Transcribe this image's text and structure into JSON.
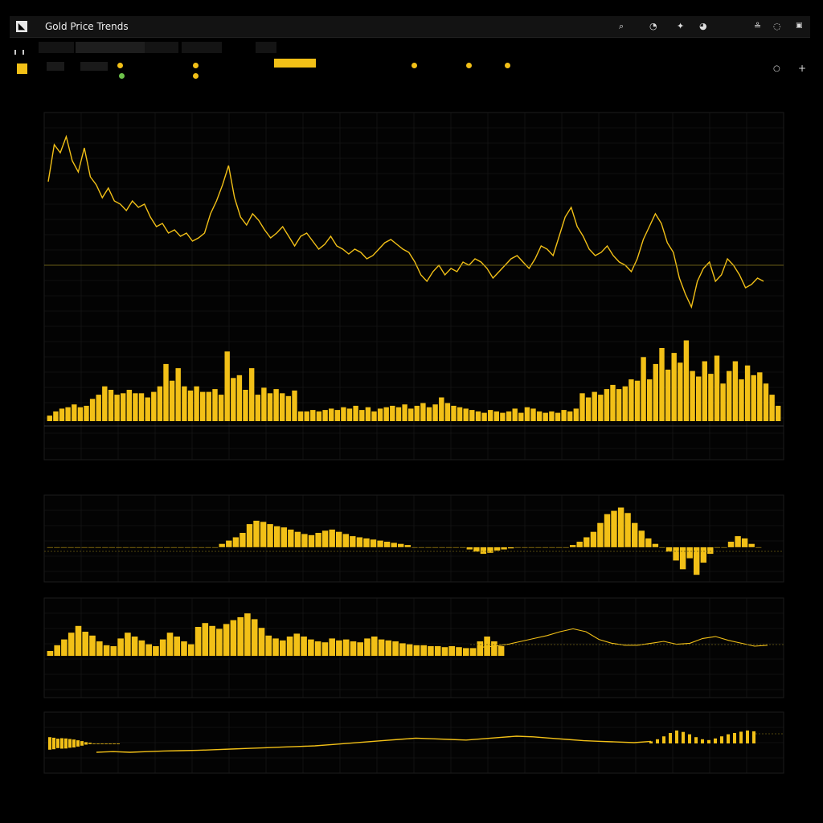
{
  "window": {
    "title": "Gold Price Trends"
  },
  "colors": {
    "accent": "#f2c017",
    "background": "#000000",
    "grid": "#1c1c1c"
  },
  "icons": [
    "search-icon",
    "bell-icon",
    "gear-icon",
    "user-icon",
    "settings-icon",
    "close-icon",
    "plus-icon"
  ],
  "chart_data": [
    {
      "type": "line",
      "x": [
        0,
        1,
        2,
        3,
        4,
        5,
        6,
        7,
        8,
        9,
        10,
        11,
        12,
        13,
        14,
        15,
        16,
        17,
        18,
        19,
        20,
        21,
        22,
        23,
        24,
        25,
        26,
        27,
        28,
        29,
        30,
        31,
        32,
        33,
        34,
        35,
        36,
        37,
        38,
        39,
        40,
        41,
        42,
        43,
        44,
        45,
        46,
        47,
        48,
        49,
        50,
        51,
        52,
        53,
        54,
        55,
        56,
        57,
        58,
        59,
        60,
        61,
        62,
        63,
        64,
        65,
        66,
        67,
        68,
        69,
        70,
        71,
        72,
        73,
        74,
        75,
        76,
        77,
        78,
        79,
        80,
        81,
        82,
        83,
        84,
        85,
        86,
        87,
        88,
        89,
        90,
        91,
        92,
        93,
        94,
        95,
        96,
        97,
        98,
        99,
        100,
        101,
        102,
        103,
        104,
        105,
        106,
        107,
        108,
        109,
        110,
        111,
        112,
        113,
        114,
        115,
        116,
        117,
        118,
        119
      ],
      "series": [
        {
          "values": [
            0.72,
            0.95,
            0.9,
            1.0,
            0.85,
            0.78,
            0.93,
            0.75,
            0.7,
            0.62,
            0.68,
            0.6,
            0.58,
            0.54,
            0.6,
            0.56,
            0.58,
            0.5,
            0.44,
            0.46,
            0.4,
            0.42,
            0.38,
            0.4,
            0.35,
            0.37,
            0.4,
            0.52,
            0.6,
            0.7,
            0.82,
            0.62,
            0.5,
            0.45,
            0.52,
            0.48,
            0.42,
            0.37,
            0.4,
            0.44,
            0.38,
            0.32,
            0.38,
            0.4,
            0.35,
            0.3,
            0.33,
            0.38,
            0.32,
            0.3,
            0.27,
            0.3,
            0.28,
            0.24,
            0.26,
            0.3,
            0.34,
            0.36,
            0.33,
            0.3,
            0.28,
            0.22,
            0.14,
            0.1,
            0.16,
            0.2,
            0.14,
            0.18,
            0.16,
            0.22,
            0.2,
            0.24,
            0.22,
            0.18,
            0.12,
            0.16,
            0.2,
            0.24,
            0.26,
            0.22,
            0.18,
            0.24,
            0.32,
            0.3,
            0.26,
            0.38,
            0.5,
            0.56,
            0.44,
            0.38,
            0.3,
            0.26,
            0.28,
            0.32,
            0.26,
            0.22,
            0.2,
            0.16,
            0.24,
            0.36,
            0.44,
            0.52,
            0.46,
            0.34,
            0.28,
            0.12,
            0.02,
            -0.06,
            0.1,
            0.18,
            0.22,
            0.1,
            0.14,
            0.24,
            0.2,
            0.14,
            0.06,
            0.08,
            0.12,
            0.1
          ]
        }
      ],
      "ylim": [
        -0.2,
        1.1
      ]
    },
    {
      "type": "bar",
      "values": [
        0.08,
        0.14,
        0.18,
        0.2,
        0.24,
        0.2,
        0.22,
        0.32,
        0.38,
        0.5,
        0.45,
        0.38,
        0.4,
        0.45,
        0.4,
        0.4,
        0.34,
        0.42,
        0.5,
        0.82,
        0.58,
        0.76,
        0.5,
        0.44,
        0.5,
        0.42,
        0.42,
        0.46,
        0.38,
        1.0,
        0.62,
        0.66,
        0.45,
        0.76,
        0.38,
        0.48,
        0.4,
        0.46,
        0.4,
        0.36,
        0.44,
        0.14,
        0.14,
        0.16,
        0.14,
        0.16,
        0.18,
        0.16,
        0.2,
        0.18,
        0.22,
        0.16,
        0.2,
        0.14,
        0.18,
        0.2,
        0.22,
        0.2,
        0.24,
        0.18,
        0.22,
        0.26,
        0.2,
        0.24,
        0.34,
        0.26,
        0.22,
        0.2,
        0.18,
        0.16,
        0.14,
        0.12,
        0.16,
        0.14,
        0.12,
        0.14,
        0.18,
        0.12,
        0.2,
        0.18,
        0.14,
        0.12,
        0.14,
        0.12,
        0.16,
        0.14,
        0.18,
        0.4,
        0.34,
        0.42,
        0.38,
        0.46,
        0.52,
        0.46,
        0.5,
        0.6,
        0.58,
        0.92,
        0.6,
        0.82,
        1.05,
        0.74,
        0.98,
        0.84,
        1.16,
        0.72,
        0.64,
        0.86,
        0.68,
        0.94,
        0.54,
        0.72,
        0.86,
        0.6,
        0.8,
        0.66,
        0.7,
        0.54,
        0.38,
        0.22
      ],
      "ylim": [
        0,
        1.2
      ]
    },
    {
      "type": "bar",
      "values": [
        0,
        0,
        0,
        0,
        0,
        0,
        0,
        0,
        0,
        0,
        0,
        0,
        0,
        0,
        0,
        0,
        0,
        0,
        0,
        0,
        0,
        0,
        0,
        0,
        0,
        0.06,
        0.12,
        0.18,
        0.26,
        0.42,
        0.48,
        0.46,
        0.42,
        0.38,
        0.36,
        0.32,
        0.28,
        0.24,
        0.22,
        0.26,
        0.3,
        0.32,
        0.28,
        0.24,
        0.2,
        0.18,
        0.16,
        0.14,
        0.12,
        0.1,
        0.08,
        0.06,
        0.04,
        0,
        0,
        0,
        0,
        0,
        0,
        0,
        0,
        -0.04,
        -0.08,
        -0.12,
        -0.1,
        -0.06,
        -0.04,
        -0.02,
        0,
        0,
        0,
        0,
        0,
        0,
        0,
        0,
        0.04,
        0.1,
        0.18,
        0.28,
        0.44,
        0.6,
        0.66,
        0.72,
        0.62,
        0.44,
        0.3,
        0.16,
        0.06,
        0,
        -0.08,
        -0.24,
        -0.4,
        -0.2,
        -0.5,
        -0.28,
        -0.12,
        0,
        0,
        0.1,
        0.2,
        0.16,
        0.06,
        0
      ],
      "ylim": [
        -0.6,
        0.8
      ]
    },
    {
      "type": "bar",
      "values": [
        0.1,
        0.22,
        0.34,
        0.48,
        0.62,
        0.5,
        0.42,
        0.3,
        0.22,
        0.2,
        0.36,
        0.48,
        0.4,
        0.32,
        0.24,
        0.2,
        0.34,
        0.48,
        0.4,
        0.3,
        0.24,
        0.6,
        0.68,
        0.62,
        0.56,
        0.66,
        0.74,
        0.8,
        0.88,
        0.76,
        0.58,
        0.42,
        0.36,
        0.32,
        0.4,
        0.46,
        0.4,
        0.34,
        0.3,
        0.28,
        0.36,
        0.32,
        0.34,
        0.3,
        0.28,
        0.36,
        0.4,
        0.34,
        0.32,
        0.3,
        0.26,
        0.24,
        0.22,
        0.22,
        0.2,
        0.2,
        0.18,
        0.2,
        0.18,
        0.16,
        0.16,
        0.3,
        0.4,
        0.3,
        0.2
      ],
      "ylim": [
        0,
        1
      ]
    },
    {
      "type": "bar",
      "values": [
        -0.6,
        -0.55,
        -0.45,
        -0.5,
        -0.48,
        -0.42,
        -0.38,
        -0.3,
        -0.22,
        -0.12,
        -0.06,
        0,
        0,
        0,
        0,
        0,
        0,
        0,
        0,
        0,
        0,
        0,
        0,
        0,
        0,
        0,
        0,
        0,
        0,
        0,
        0,
        0,
        0,
        0,
        0,
        0.1,
        0.2,
        0.34,
        0.5,
        0.62,
        0.55,
        0.44,
        0.3,
        0.2,
        0.16,
        0.24,
        0.34,
        0.44,
        0.5,
        0.56,
        0.62,
        0.58
      ],
      "ylim": [
        -1,
        1
      ]
    },
    {
      "type": "line",
      "series": [
        {
          "values": [
            0.1,
            0.12,
            0.1,
            0.12,
            0.14,
            0.15,
            0.16,
            0.18,
            0.2,
            0.22,
            0.24,
            0.26,
            0.28,
            0.3,
            0.34,
            0.38,
            0.42,
            0.46,
            0.5,
            0.54,
            0.52,
            0.5,
            0.48,
            0.52,
            0.56,
            0.6,
            0.58,
            0.54,
            0.5,
            0.46,
            0.44,
            0.42,
            0.4,
            0.44
          ]
        }
      ],
      "ylim": [
        0,
        1
      ]
    }
  ]
}
